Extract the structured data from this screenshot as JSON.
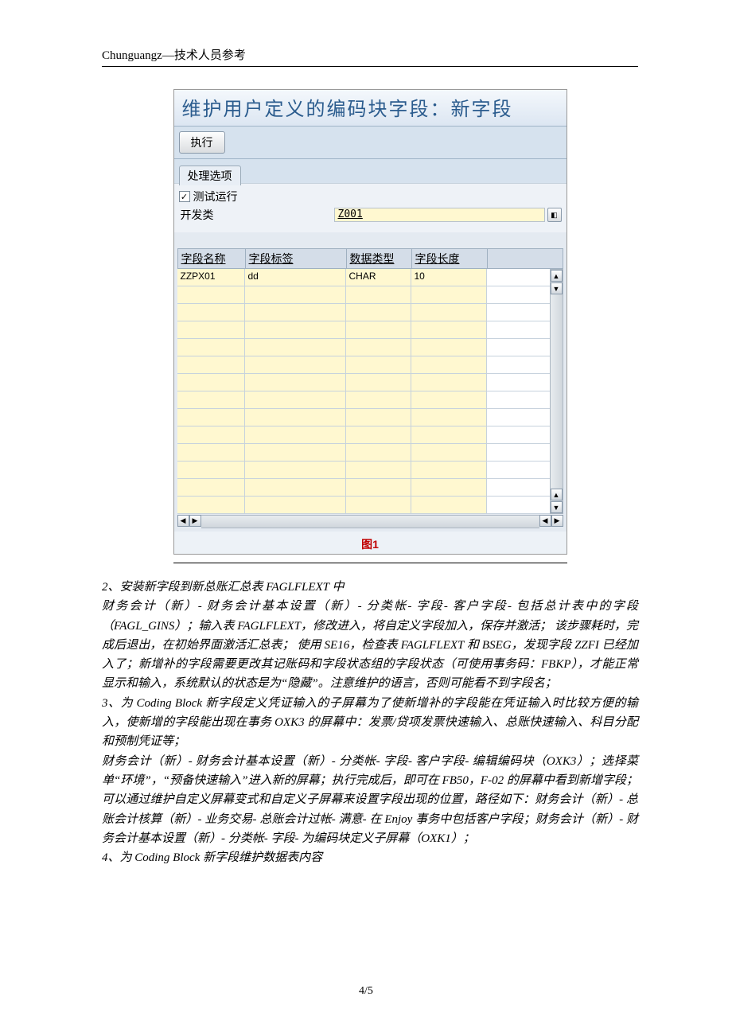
{
  "header": "Chunguangz—技术人员参考",
  "sap": {
    "title": "维护用户定义的编码块字段：新字段",
    "execute": "执行",
    "tab": "处理选项",
    "checkbox_label": "测试运行",
    "dev_class_label": "开发类",
    "dev_class_value": "Z001",
    "grid": {
      "headers": {
        "c1": "字段名称",
        "c2": "字段标签",
        "c3": "数据类型",
        "c4": "字段长度"
      },
      "row": {
        "c1": "ZZPX01",
        "c2": "dd",
        "c3": "CHAR",
        "c4": "10"
      }
    }
  },
  "caption": "图1",
  "para": {
    "p1": "2、安装新字段到新总账汇总表 FAGLFLEXT 中",
    "p2": "财务会计（新）- 财务会计基本设置（新）- 分类帐- 字段- 客户字段- 包括总计表中的字段（FAGL_GINS）；输入表 FAGLFLEXT，修改进入，将自定义字段加入，保存并激活； 该步骤耗时，完成后退出，在初始界面激活汇总表； 使用 SE16，检查表 FAGLFLEXT 和 BSEG，发现字段 ZZFI 已经加入了；新增补的字段需要更改其记账码和字段状态组的字段状态（可使用事务码：FBKP），才能正常显示和输入，系统默认的状态是为“隐藏”。注意维护的语言，否则可能看不到字段名；",
    "p3": "3、为 Coding Block 新字段定义凭证输入的子屏幕为了使新增补的字段能在凭证输入时比较方便的输入，使新增的字段能出现在事务 OXK3 的屏幕中：发票/贷项发票快速输入、总账快速输入、科目分配和预制凭证等；",
    "p4": "财务会计（新）- 财务会计基本设置（新）- 分类帐- 字段- 客户字段- 编辑编码块（OXK3）；选择菜单“环境”，“预备快速输入”进入新的屏幕；执行完成后，即可在 FB50，F-02 的屏幕中看到新增字段；可以通过维护自定义屏幕变式和自定义子屏幕来设置字段出现的位置，路径如下：财务会计（新）- 总账会计核算（新）- 业务交易- 总账会计过帐- 满意- 在 Enjoy 事务中包括客户字段；财务会计（新）- 财务会计基本设置（新）- 分类帐- 字段- 为编码块定义子屏幕（OXK1）；",
    "p5": "4、为 Coding Block 新字段维护数据表内容"
  },
  "pagenum": "4/5"
}
